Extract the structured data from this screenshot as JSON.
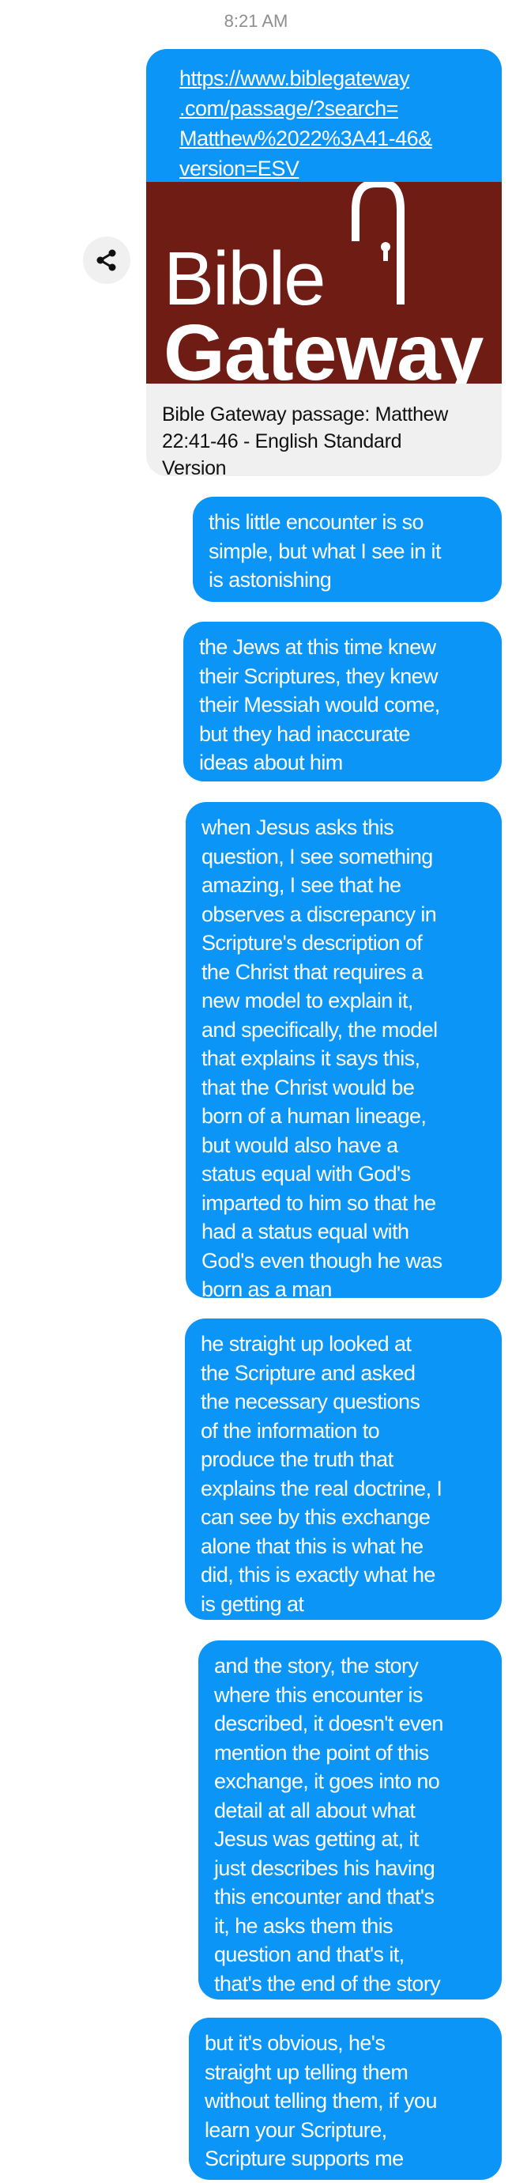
{
  "timestamp": "8:21 AM",
  "link_card": {
    "url_lines": [
      "https://www.biblegateway",
      ".com/passage/?search=",
      "Matthew%2022%3A41-46&",
      "version=ESV"
    ],
    "logo_text": [
      "Bible",
      "Gateway"
    ],
    "title_lines": [
      "Bible Gateway passage: Matthew",
      "22:41-46 - English Standard",
      "Version"
    ]
  },
  "share_icon": "share-icon",
  "colors": {
    "bubble": "#0a95f7",
    "card_bg": "#f0f0f0",
    "logo_bg": "#6e1c14"
  },
  "messages": [
    {
      "lines": [
        "this little encounter is so",
        "simple, but what I see in it",
        "is astonishing"
      ]
    },
    {
      "lines": [
        "the Jews at this time knew",
        "their Scriptures, they knew",
        "their Messiah would come,",
        "but they had inaccurate",
        "ideas about him"
      ]
    },
    {
      "lines": [
        "when Jesus asks this",
        "question, I see something",
        "amazing, I see that he",
        "observes a discrepancy in",
        "Scripture's description of",
        "the Christ that requires a",
        "new model to explain it,",
        "and specifically, the model",
        "that explains it says this,",
        "that the Christ would be",
        "born of a human lineage,",
        "but would also have a",
        "status equal with God's",
        "imparted to him so that he",
        "had a status equal with",
        "God's even though he was",
        "born as a man"
      ]
    },
    {
      "lines": [
        "he straight up looked at",
        "the Scripture and asked",
        "the necessary questions",
        "of the information to",
        "produce the truth that",
        "explains the real doctrine, I",
        "can see by this exchange",
        "alone that this is what he",
        "did, this is exactly what he",
        "is getting at"
      ]
    },
    {
      "lines": [
        "and the story, the story",
        "where this encounter is",
        "described, it doesn't even",
        "mention the point of this",
        "exchange, it goes into no",
        "detail at all about what",
        "Jesus was getting at, it",
        "just describes his having",
        "this encounter and that's",
        "it, he asks them this",
        "question and that's it,",
        "that's the end of the story"
      ]
    },
    {
      "lines": [
        "but it's obvious, he's",
        "straight up telling them",
        "without telling them, if you",
        "learn your Scripture,",
        "Scripture supports me"
      ]
    }
  ]
}
